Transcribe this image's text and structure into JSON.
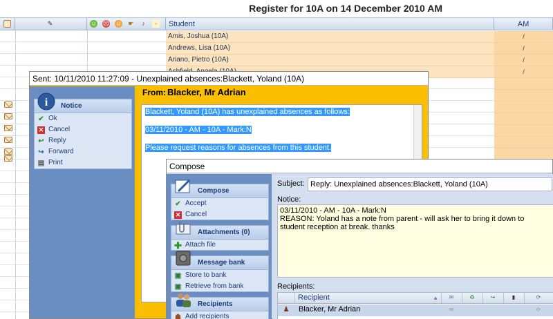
{
  "register": {
    "title": "Register for 10A on 14 December 2010 AM",
    "columns": {
      "student": "Student",
      "am": "AM"
    },
    "students": [
      {
        "name": "Amis, Joshua (10A)",
        "am": "/"
      },
      {
        "name": "Andrews, Lisa (10A)",
        "am": "/"
      },
      {
        "name": "Ariano, Pietro (10A)",
        "am": "/"
      },
      {
        "name": "Ashfield, Angela (10A)",
        "am": "/"
      }
    ]
  },
  "notice_window": {
    "title": "Sent: 10/11/2010 11:27:09 - Unexplained absences:Blackett, Yoland (10A)",
    "sidebar": {
      "panel_title": "Notice",
      "items": [
        {
          "label": "Ok",
          "icon": "check-icon"
        },
        {
          "label": "Cancel",
          "icon": "cancel-icon"
        },
        {
          "label": "Reply",
          "icon": "reply-icon"
        },
        {
          "label": "Forward",
          "icon": "forward-icon"
        },
        {
          "label": "Print",
          "icon": "printer-icon"
        }
      ]
    },
    "from_label": "From:",
    "from_name": "Blacker, Mr Adrian",
    "body": {
      "line1": "Blackett, Yoland (10A) has unexplained absences as follows:",
      "line2": "03/11/2010 - AM - 10A - Mark:N",
      "line3": "Please request reasons for absences from this student."
    }
  },
  "compose_window": {
    "title": "Compose",
    "sidebar": {
      "compose": {
        "title": "Compose",
        "items": [
          "Accept",
          "Cancel"
        ]
      },
      "attachments": {
        "title": "Attachments (0)",
        "items": [
          "Attach file"
        ]
      },
      "message_bank": {
        "title": "Message bank",
        "items": [
          "Store to bank",
          "Retrieve from bank"
        ]
      },
      "recipients": {
        "title": "Recipients",
        "items": [
          "Add recipients"
        ]
      }
    },
    "subject_label": "Subject:",
    "subject_value": "Reply: Unexplained absences:Blackett, Yoland (10A)",
    "notice_label": "Notice:",
    "notice_value": "03/11/2010 - AM - 10A - Mark:N\nREASON: Yoland has a note from parent - will ask her to bring it down to student reception at break. thanks",
    "recipients_label": "Recipients:",
    "recipients_grid": {
      "header": "Recipient",
      "rows": [
        {
          "name": "Blacker, Mr Adrian"
        }
      ]
    }
  },
  "colors": {
    "accent_orange": "#fbbf00",
    "sidebar_blue": "#6a8ec2",
    "selection_blue": "#3399ff",
    "row_highlight": "#fde4c0"
  }
}
